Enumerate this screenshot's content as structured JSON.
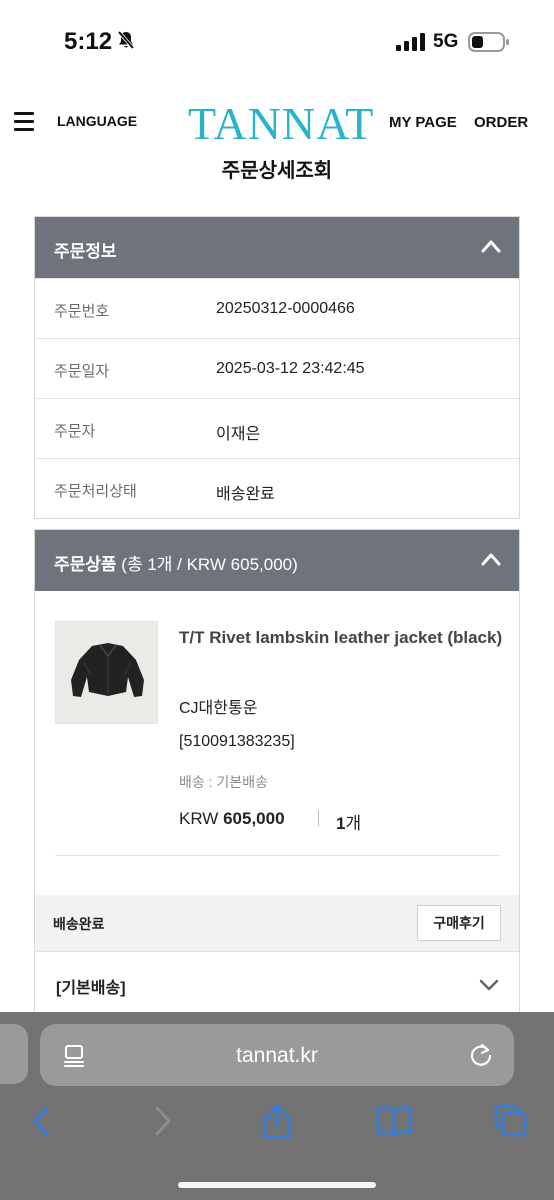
{
  "status_bar": {
    "time": "5:12",
    "network": "5G"
  },
  "header": {
    "language": "LANGUAGE",
    "logo": "TANNAT",
    "my_page": "MY PAGE",
    "order": "ORDER",
    "page_title": "주문상세조회"
  },
  "order_info": {
    "title": "주문정보",
    "rows": [
      {
        "label": "주문번호",
        "value": "20250312-0000466"
      },
      {
        "label": "주문일자",
        "value": "2025-03-12 23:42:45"
      },
      {
        "label": "주문자",
        "value": "이재은"
      },
      {
        "label": "주문처리상태",
        "value": "배송완료"
      }
    ]
  },
  "order_items": {
    "title": "주문상품",
    "summary": "(총 1개 / KRW 605,000)",
    "product": {
      "name": "T/T Rivet lambskin leather jacket (black)",
      "carrier": "CJ대한통운",
      "tracking": "[510091383235]",
      "shipping": "배송 : 기본배송",
      "currency": "KRW",
      "price": "605,000",
      "qty_num": "1",
      "qty_unit": "개"
    },
    "status": "배송완료",
    "review_button": "구매후기",
    "shipping_group": "[기본배송]"
  },
  "browser": {
    "url": "tannat.kr"
  },
  "colors": {
    "panel_header": "#6f737c",
    "logo": "#27b3c8",
    "browser_bar": "#737373",
    "toolbar_icon": "#2f7fe6"
  }
}
